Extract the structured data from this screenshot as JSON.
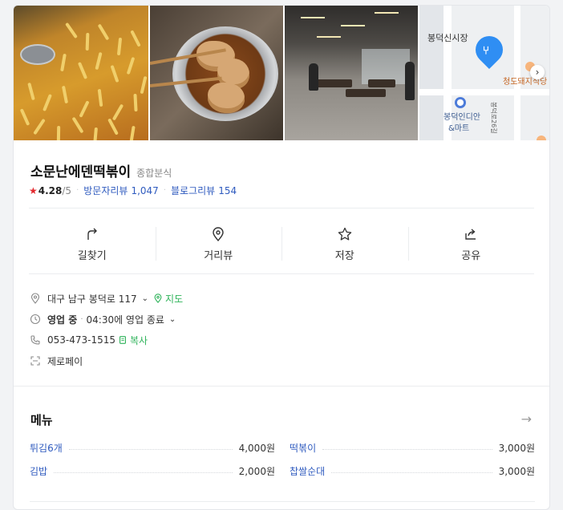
{
  "place": {
    "name": "소문난에덴떡볶이",
    "category": "종합분식",
    "rating": "4.28",
    "rating_max": "/5",
    "visitor_review_label": "방문자리뷰",
    "visitor_review_count": "1,047",
    "blog_review_label": "블로그리뷰",
    "blog_review_count": "154"
  },
  "map": {
    "label_area": "봉덕신시장",
    "label_store": "봉덕인디안\n&마트",
    "label_store_line1": "봉덕인디안",
    "label_store_line2": "&마트",
    "label_shop": "청도돼지식당",
    "label_road": "봉덕로26길",
    "pin_color": "#2f8ef3"
  },
  "actions": [
    {
      "label": "길찾기",
      "icon": "directions-icon"
    },
    {
      "label": "거리뷰",
      "icon": "pin-icon"
    },
    {
      "label": "저장",
      "icon": "star-icon"
    },
    {
      "label": "공유",
      "icon": "share-icon"
    }
  ],
  "info": {
    "address": "대구 남구 봉덕로 117",
    "map_link": "지도",
    "status": "영업 중",
    "hours": "04:30에 영업 종료",
    "phone": "053-473-1515",
    "copy_label": "복사",
    "payment": "제로페이"
  },
  "menu": {
    "title": "메뉴",
    "items": [
      {
        "name": "튀김6개",
        "price": "4,000원"
      },
      {
        "name": "떡볶이",
        "price": "3,000원"
      },
      {
        "name": "김밥",
        "price": "2,000원"
      },
      {
        "name": "찹쌀순대",
        "price": "3,000원"
      }
    ]
  },
  "colors": {
    "accent_blue": "#2f5bbf",
    "star_red": "#e2282d",
    "map_green": "#2fb35a"
  }
}
